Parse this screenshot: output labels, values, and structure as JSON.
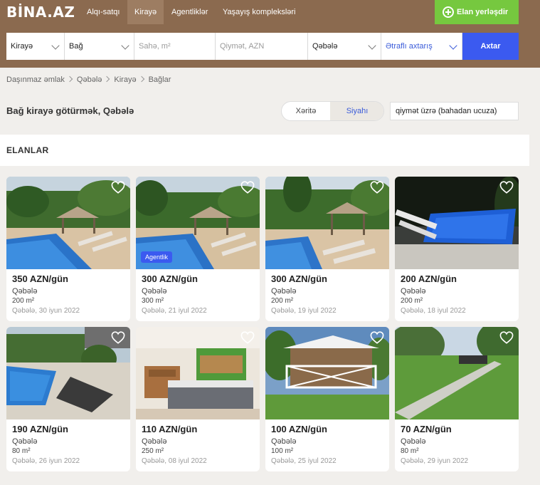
{
  "header": {
    "logo": "BİNA.AZ",
    "nav": [
      {
        "label": "Alqı-satqı"
      },
      {
        "label": "Kirayə"
      },
      {
        "label": "Agentliklər"
      },
      {
        "label": "Yaşayış kompleksləri"
      }
    ],
    "post_button": "Elan yerləşdir"
  },
  "search": {
    "deal_type": "Kirayə",
    "category": "Bağ",
    "area_placeholder": "Sahə, m²",
    "price_placeholder": "Qiymət, AZN",
    "city": "Qəbələ",
    "advanced": "Ətraflı axtarış",
    "submit": "Axtar"
  },
  "breadcrumb": [
    "Daşınmaz əmlak",
    "Qəbələ",
    "Kirayə",
    "Bağlar"
  ],
  "page_title": "Bağ kirayə götürmək, Qəbələ",
  "view_toggle": {
    "map": "Xəritə",
    "list": "Siyahı"
  },
  "sort": {
    "selected": "qiymət üzrə (bahadan ucuza)"
  },
  "section_title": "ELANLAR",
  "listings": [
    {
      "price": "350 AZN/gün",
      "city": "Qəbələ",
      "area": "200 m²",
      "date": "Qəbələ, 30 iyun 2022",
      "badge": ""
    },
    {
      "price": "300 AZN/gün",
      "city": "Qəbələ",
      "area": "300 m²",
      "date": "Qəbələ, 21 iyul 2022",
      "badge": "Agentlik"
    },
    {
      "price": "300 AZN/gün",
      "city": "Qəbələ",
      "area": "200 m²",
      "date": "Qəbələ, 19 iyul 2022",
      "badge": ""
    },
    {
      "price": "200 AZN/gün",
      "city": "Qəbələ",
      "area": "200 m²",
      "date": "Qəbələ, 18 iyul 2022",
      "badge": ""
    },
    {
      "price": "190 AZN/gün",
      "city": "Qəbələ",
      "area": "80 m²",
      "date": "Qəbələ, 26 iyun 2022",
      "badge": ""
    },
    {
      "price": "110 AZN/gün",
      "city": "Qəbələ",
      "area": "250 m²",
      "date": "Qəbələ, 08 iyul 2022",
      "badge": ""
    },
    {
      "price": "100 AZN/gün",
      "city": "Qəbələ",
      "area": "100 m²",
      "date": "Qəbələ, 25 iyul 2022",
      "badge": ""
    },
    {
      "price": "70 AZN/gün",
      "city": "Qəbələ",
      "area": "80 m²",
      "date": "Qəbələ, 29 iyun 2022",
      "badge": ""
    }
  ],
  "colors": {
    "brand": "#8b6a4f",
    "accent_blue": "#3b5af0",
    "post_green": "#76c83f"
  },
  "icons": {
    "favorite": "heart-icon",
    "dropdown": "chevron-down-icon",
    "post": "plus-circle-icon"
  }
}
